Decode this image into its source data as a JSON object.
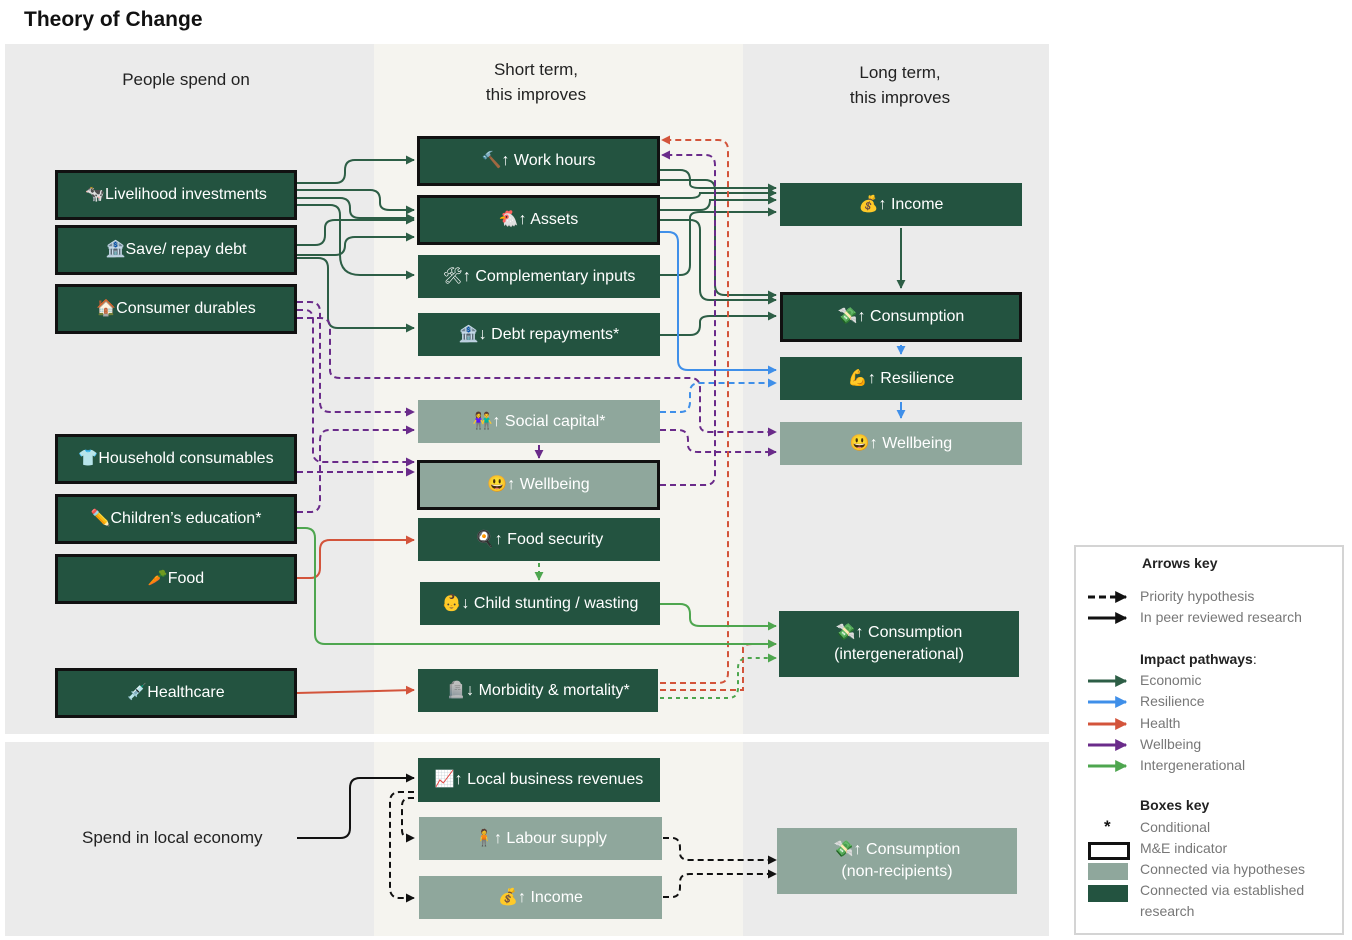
{
  "title": "Theory of Change",
  "columns": {
    "spend": "People spend on",
    "short": "Short term,\nthis improves",
    "long": "Long term,\nthis improves"
  },
  "spend_items": {
    "livelihood": "🐄Livelihood investments",
    "save": "🏦Save/ repay debt",
    "durables": "🏠Consumer durables",
    "household": "👕Household consumables",
    "education": "✏️Children’s education*",
    "food": "🥕Food",
    "healthcare": "💉Healthcare"
  },
  "short_items": {
    "work_hours": "🔨↑ Work hours",
    "assets": "🐔↑ Assets",
    "complementary": "🛠↑ Complementary inputs",
    "debt": "🏦↓ Debt repayments*",
    "social": "👫↑ Social capital*",
    "wellbeing": "😃↑ Wellbeing",
    "food_security": "🍳↑ Food security",
    "stunting": "👶↓ Child stunting / wasting",
    "morbidity": "🪦↓ Morbidity & mortality*"
  },
  "long_items": {
    "income": "💰↑ Income",
    "consumption": "💸↑ Consumption",
    "resilience": "💪↑ Resilience",
    "wellbeing": "😃↑ Wellbeing",
    "consumption_inter": "💸↑ Consumption\n(intergenerational)"
  },
  "local": {
    "label": "Spend in local economy",
    "revenues": "📈↑ Local business revenues",
    "labour": "🧍↑ Labour supply",
    "income": "💰↑ Income",
    "consumption": "💸↑ Consumption\n(non-recipients)"
  },
  "key": {
    "arrows_title": "Arrows key",
    "priority": "Priority hypothesis",
    "peer": "In peer reviewed research",
    "pathways_title": "Impact pathways",
    "pathways_colon": ":",
    "economic": "Economic",
    "resilience": "Resilience",
    "health": "Health",
    "wellbeing": "Wellbeing",
    "intergenerational": "Intergenerational",
    "boxes_title": "Boxes key",
    "conditional_mark": "*",
    "conditional": "Conditional",
    "me": "M&E indicator",
    "hypotheses": "Connected via hypotheses",
    "established": "Connected via established",
    "established2": "research"
  },
  "colors": {
    "economic": "#2d5e46",
    "resilience": "#3f8fe9",
    "health": "#d3543b",
    "wellbeing": "#6a2b8a",
    "intergenerational": "#4ea64f",
    "box_dark": "#235340",
    "box_light": "#8fa79c"
  }
}
